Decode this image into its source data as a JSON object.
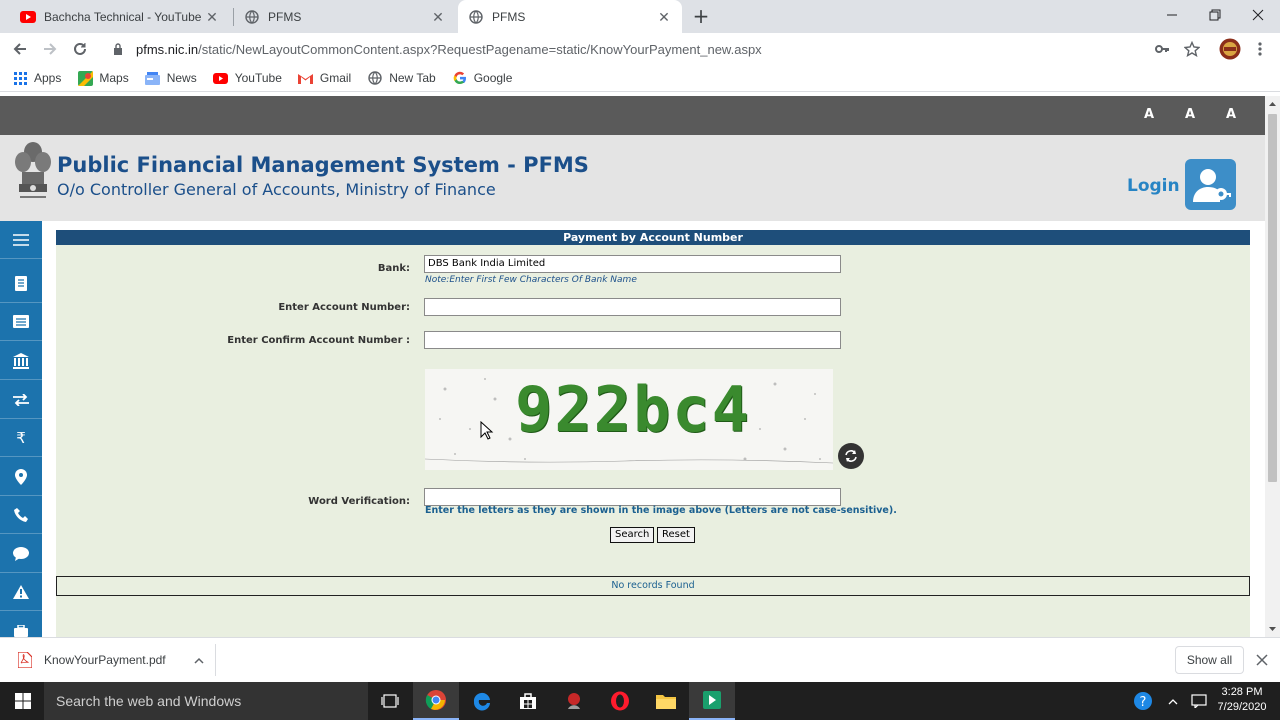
{
  "browser": {
    "tabs": [
      {
        "title": "Bachcha Technical - YouTube",
        "active": false
      },
      {
        "title": "PFMS",
        "active": false
      },
      {
        "title": "PFMS",
        "active": true
      }
    ],
    "url_host": "pfms.nic.in",
    "url_path": "/static/NewLayoutCommonContent.aspx?RequestPagename=static/KnowYourPayment_new.aspx",
    "bookmarks": [
      "Apps",
      "Maps",
      "News",
      "YouTube",
      "Gmail",
      "New Tab",
      "Google"
    ]
  },
  "site": {
    "font_size_buttons": [
      "A",
      "A",
      "A"
    ],
    "title": "Public Financial Management System - PFMS",
    "subtitle": "O/o Controller General of Accounts, Ministry of Finance",
    "login_label": "Login"
  },
  "form": {
    "panel_title": "Payment by Account Number",
    "bank_label": "Bank:",
    "bank_value": "DBS Bank India Limited",
    "bank_note": "Note:Enter First Few Characters Of Bank Name",
    "account_label": "Enter Account Number:",
    "account_value": "",
    "confirm_label": "Enter Confirm Account Number :",
    "confirm_value": "",
    "captcha_text": "922bc4",
    "word_label": "Word Verification:",
    "word_value": "",
    "word_hint": "Enter the letters as they are shown in the image above (Letters are not case-sensitive).",
    "search_label": "Search",
    "reset_label": "Reset",
    "result_text": "No records Found"
  },
  "downloads": {
    "file_name": "KnowYourPayment.pdf",
    "show_all": "Show all"
  },
  "taskbar": {
    "search_placeholder": "Search the web and Windows",
    "time": "3:28 PM",
    "date": "7/29/2020"
  }
}
